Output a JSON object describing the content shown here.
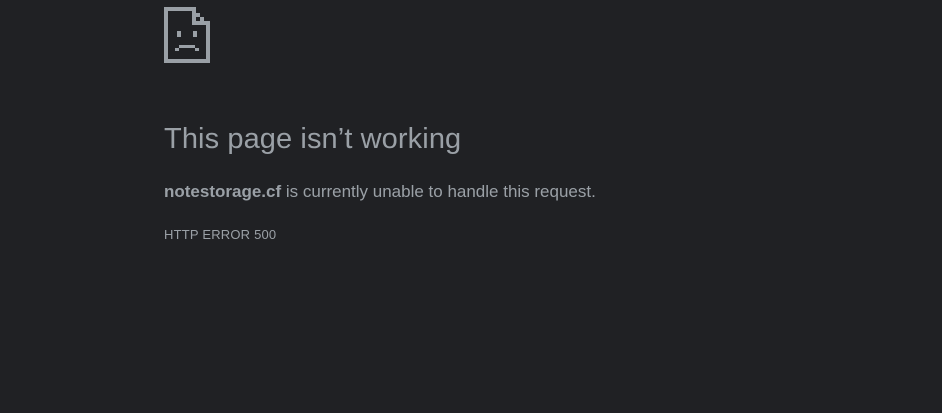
{
  "error_page": {
    "icon": "sad-page-icon",
    "headline": "This page isn’t working",
    "host": "notestorage.cf",
    "message": " is currently unable to handle this request.",
    "error_code": "HTTP ERROR 500"
  },
  "colors": {
    "background": "#202124",
    "text": "#9aa0a6"
  }
}
